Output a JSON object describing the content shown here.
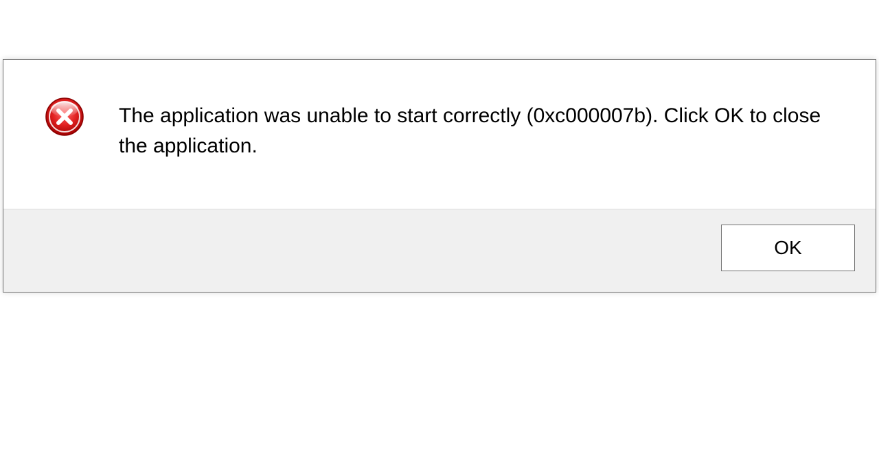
{
  "dialog": {
    "icon": "error-icon",
    "message": "The application was unable to start correctly (0xc000007b). Click OK to close the application.",
    "buttons": {
      "ok_label": "OK"
    }
  }
}
